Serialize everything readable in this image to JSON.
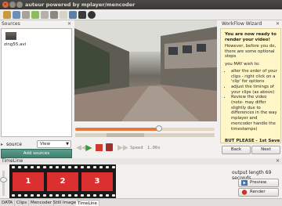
{
  "window": {
    "title": "auteur powered by mplayer/mencoder"
  },
  "toolbar": {
    "icons": [
      "folder-icon",
      "save-icon",
      "scissors-icon",
      "refresh-icon",
      "list-icon",
      "grid-icon",
      "effects-icon",
      "image-icon",
      "display-icon",
      "record-icon"
    ]
  },
  "sources": {
    "header": "Sources",
    "files": [
      {
        "name": "zing55.avi"
      }
    ],
    "source_label": "source",
    "view_select": "View",
    "add_button": "Add sources"
  },
  "player": {
    "speed_label": "Speed",
    "speed_value": "1.00x",
    "seek_fraction": 0.6
  },
  "wizard": {
    "header": "WorkFlow Wizard",
    "heading": "You are now ready to render your video!",
    "intro": "However, before you do, there are some optional steps",
    "wish_label": "you MAY wish to:",
    "items": [
      "alter the order of your clips - right click on a 'clip' for options",
      "adjust the timings of your clips (as above)",
      "Review the video (note- may differ slightly due to differences in the way mplayer and mencoder handle the timestamps)"
    ],
    "cut_line": "BUT PLEASE - 1st Save",
    "back_button": "Back",
    "next_button": "Next"
  },
  "timeline": {
    "header": "TimeLine",
    "clips": [
      "1",
      "2",
      "3"
    ],
    "output_length": "output length 69 seconds",
    "preview_button": "Preview",
    "render_button": "Render"
  },
  "tabs": [
    "DATA",
    "Clips",
    "Mencoder",
    "Still Images",
    "TimeLine"
  ],
  "colors": {
    "accent": "#e27b3c",
    "clip": "#dc2f2f",
    "wizard_bg": "#fff7c8",
    "sources_button": "#4a8c7c"
  }
}
